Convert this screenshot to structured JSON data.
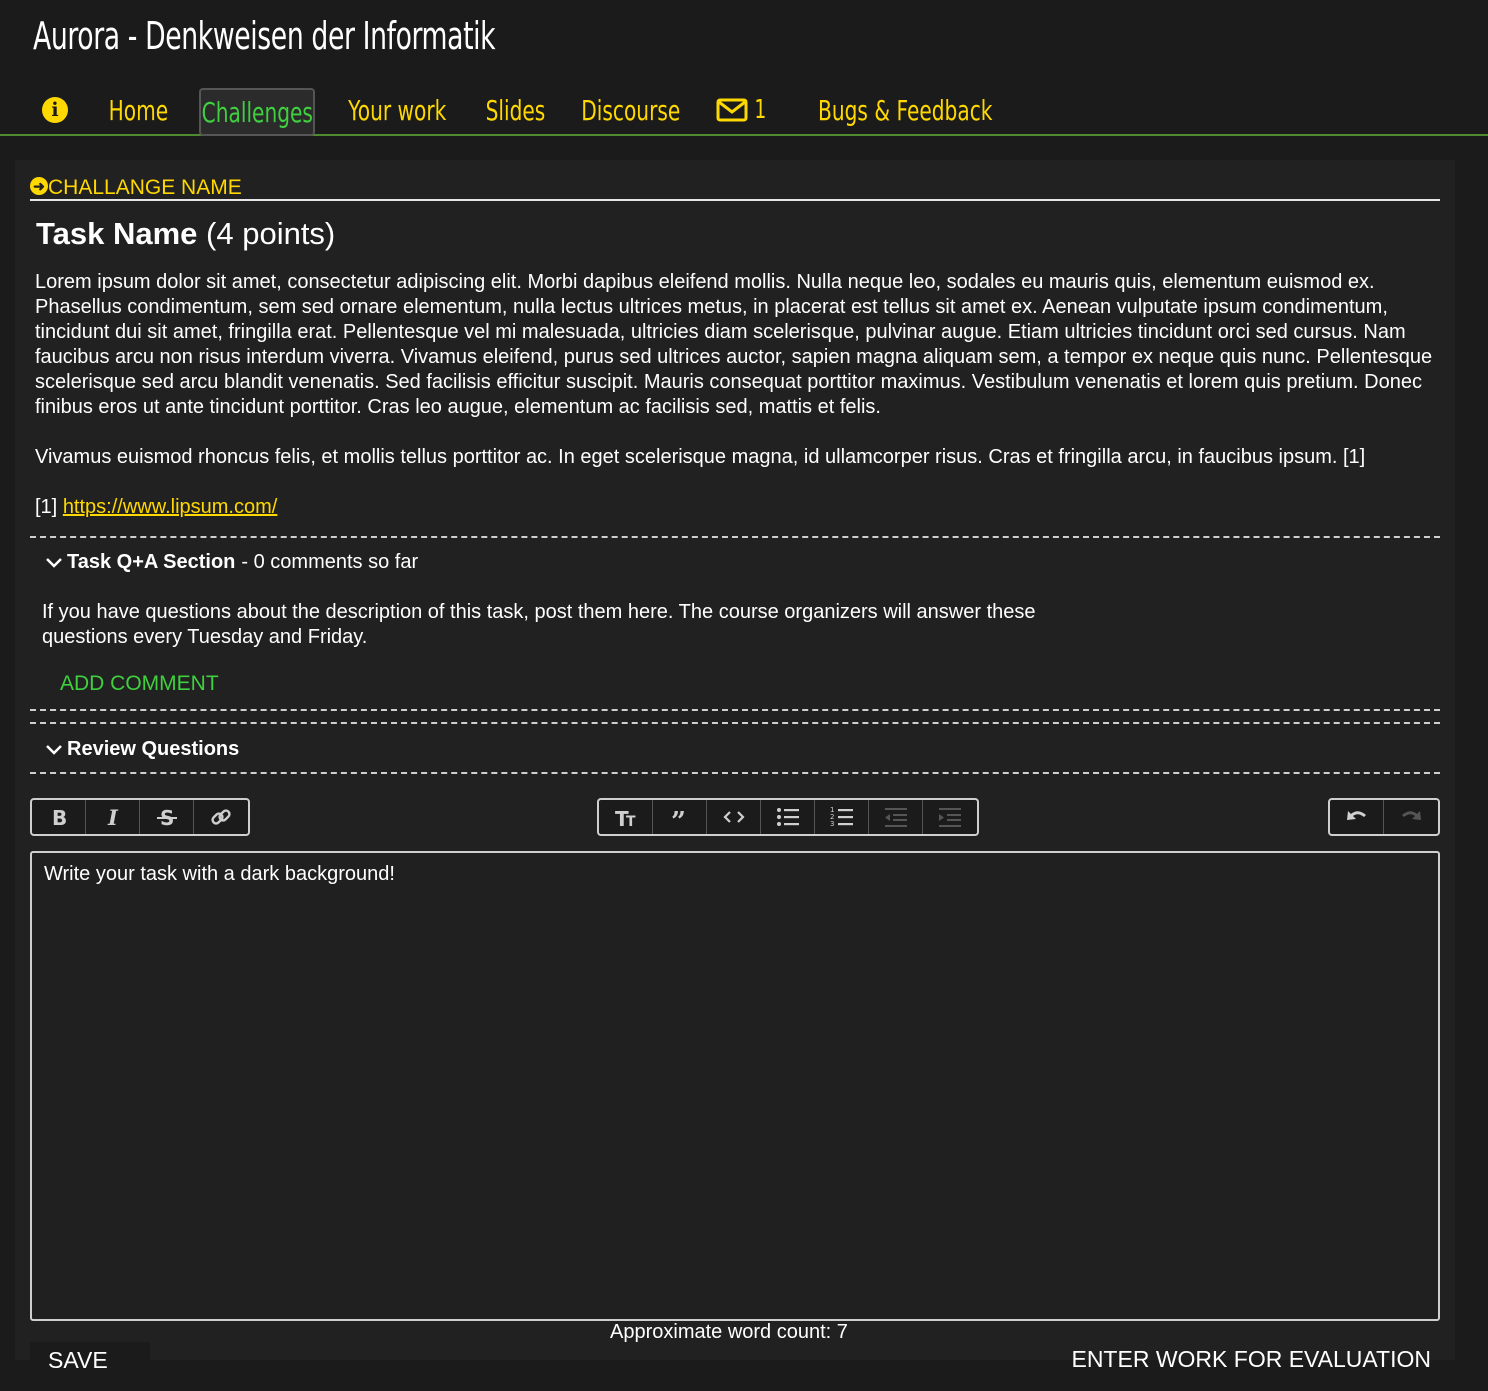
{
  "app": {
    "title": "Aurora - Denkweisen der Informatik"
  },
  "nav": {
    "info_icon": "info-circle-icon",
    "home": "Home",
    "challenges": "Challenges",
    "your_work": "Your work",
    "slides": "Slides",
    "discourse": "Discourse",
    "mail_icon": "envelope-icon",
    "mail_count": "1",
    "bugs_icon": "arrow-right-icon",
    "bugs": "Bugs & Feedback",
    "active": "Challenges"
  },
  "challenge": {
    "name": "CHALLANGE NAME",
    "task_name": "Task Name",
    "points": "(4 points)"
  },
  "description": {
    "paragraph1": "Lorem ipsum dolor sit amet, consectetur adipiscing elit. Morbi dapibus eleifend mollis. Nulla neque leo, sodales eu mauris quis, elementum euismod ex. Phasellus condimentum, sem sed ornare elementum, nulla lectus ultrices metus, in placerat est tellus sit amet ex. Aenean vulputate ipsum condimentum, tincidunt dui sit amet, fringilla erat. Pellentesque vel mi malesuada, ultricies diam scelerisque, pulvinar augue. Etiam ultricies tincidunt orci sed cursus. Nam faucibus arcu non risus interdum viverra. Vivamus eleifend, purus sed ultrices auctor, sapien magna aliquam sem, a tempor ex neque quis nunc. Pellentesque scelerisque sed arcu blandit venenatis. Sed facilisis efficitur suscipit. Mauris consequat porttitor maximus. Vestibulum venenatis et lorem quis pretium. Donec finibus eros ut ante tincidunt porttitor. Cras leo augue, elementum ac facilisis sed, mattis et felis.",
    "paragraph2": "Vivamus euismod rhoncus felis, et mollis tellus porttitor ac. In eget scelerisque magna, id ullamcorper risus. Cras et fringilla arcu, in faucibus ipsum. [1]",
    "ref_marker": "[1]",
    "ref_link": "https://www.lipsum.com/"
  },
  "qa": {
    "title": "Task Q+A Section",
    "count": "- 0 comments so far",
    "text": "If you have questions about the description of this task, post them here. The course organizers will answer these questions every Tuesday and Friday.",
    "add_comment": "ADD COMMENT"
  },
  "review": {
    "title": "Review Questions"
  },
  "toolbar": {
    "left": [
      "bold-icon",
      "italic-icon",
      "strikethrough-icon",
      "link-icon"
    ],
    "middle": [
      "heading-icon",
      "quote-icon",
      "code-icon",
      "bulleted-list-icon",
      "numbered-list-icon",
      "outdent-icon",
      "indent-icon"
    ],
    "right": [
      "undo-icon",
      "redo-icon"
    ]
  },
  "editor": {
    "content": "Write your task with a dark background!"
  },
  "footer": {
    "word_count": "Approximate word count: 7",
    "save": "SAVE",
    "submit": "ENTER WORK FOR EVALUATION"
  },
  "colors": {
    "accent_yellow": "#ffd800",
    "accent_green": "#3fcf3f",
    "background": "#1b1b1b",
    "panel": "#212121"
  }
}
